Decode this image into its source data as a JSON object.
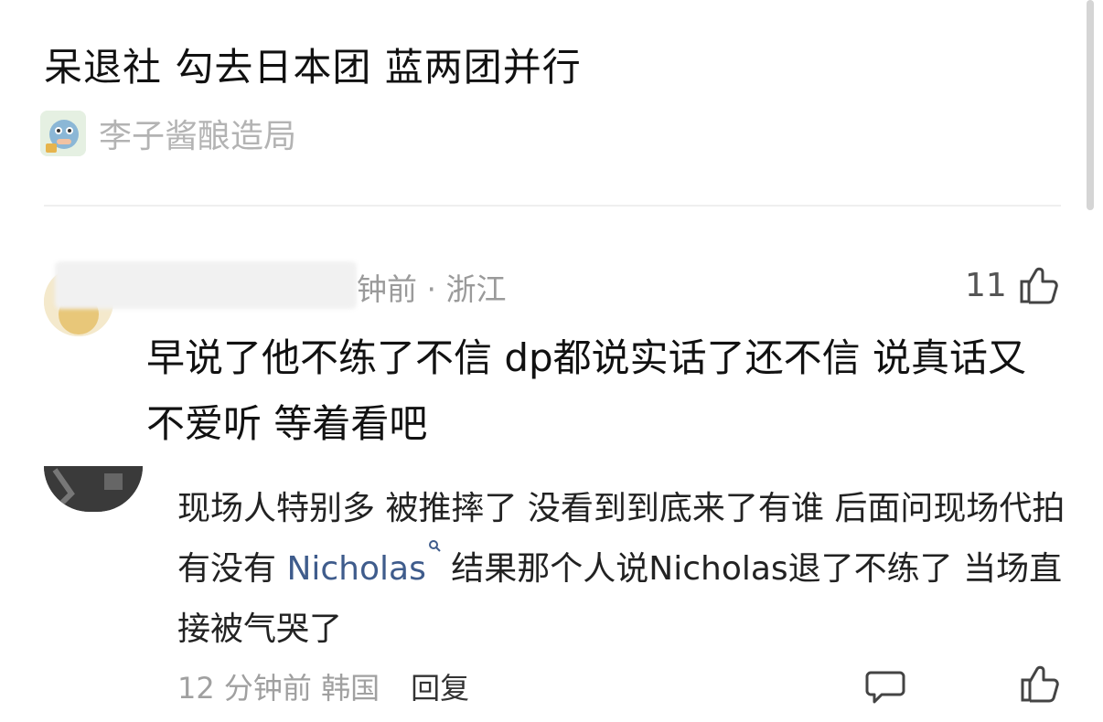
{
  "post": {
    "title": "呆退社 勾去日本团 蓝两团并行",
    "author": "李子酱酿造局"
  },
  "comment_main": {
    "meta": "钟前 · 浙江",
    "likes": "11",
    "text": "早说了他不练了不信 dp都说实话了还不信 说真话又不爱听 等着看吧"
  },
  "comment_reply": {
    "text_before": "现场人特别多 被推摔了 没看到到底来了有谁 后面问现场代拍有没有 ",
    "mention": "Nicholas",
    "text_after": " 结果那个人说Nicholas退了不练了 当场直接被气哭了",
    "time_loc": "12 分钟前 韩国",
    "reply_label": "回复"
  },
  "icons": {
    "author_avatar": "author-avatar",
    "thumb": "thumb-up-icon",
    "message": "message-icon",
    "search": "search-icon"
  },
  "colors": {
    "muted": "#9a9a9a",
    "mention": "#3f5c8c"
  }
}
